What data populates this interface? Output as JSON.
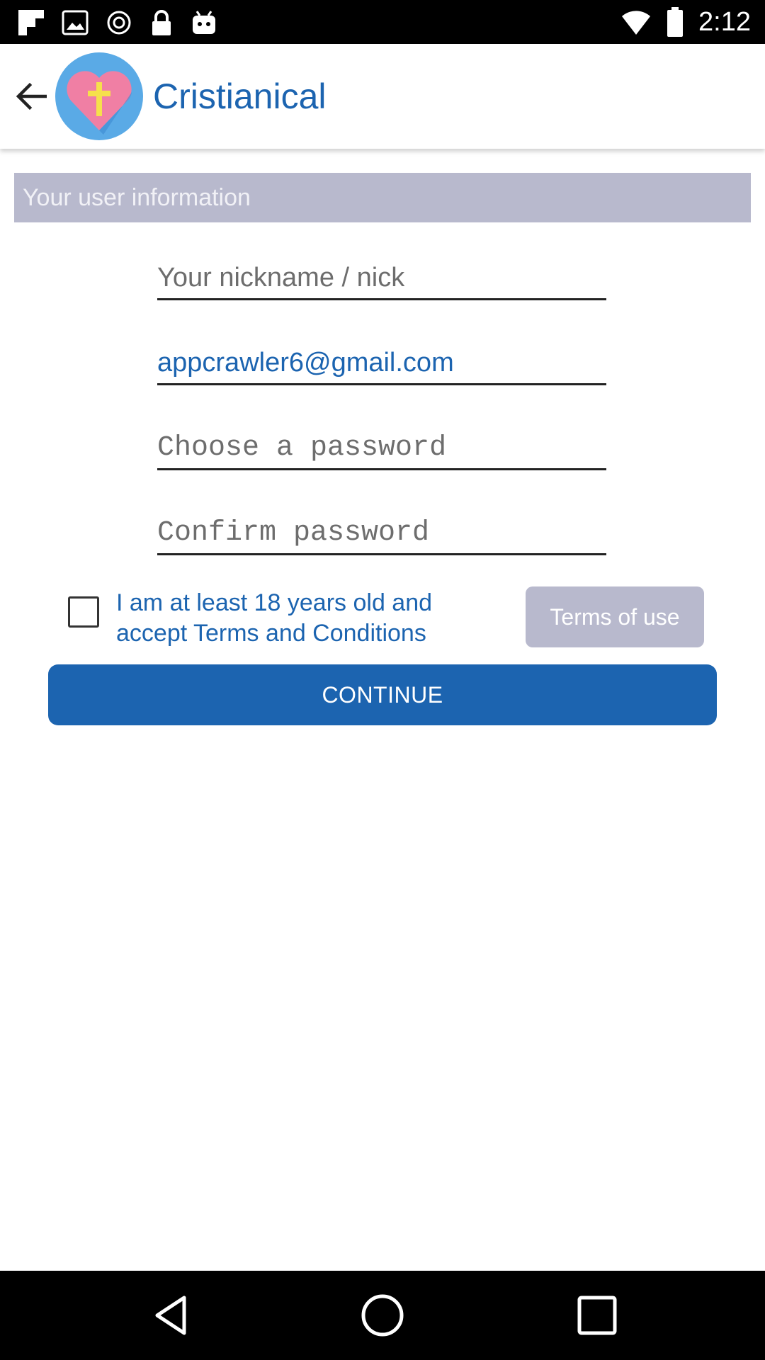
{
  "status_bar": {
    "time": "2:12",
    "icons": [
      "flipboard-icon",
      "image-icon",
      "sync-icon",
      "lock-icon",
      "android-icon",
      "wifi-icon",
      "battery-icon"
    ]
  },
  "toolbar": {
    "title": "Cristianical",
    "back_icon": "arrow-left-icon",
    "logo_icon": "heart-cross-logo"
  },
  "section": {
    "title": "Your user information"
  },
  "form": {
    "nickname_placeholder": "Your nickname / nick",
    "nickname_value": "",
    "email_value": "appcrawler6@gmail.com",
    "email_placeholder": "",
    "password_placeholder": "Choose a password",
    "confirm_placeholder": "Confirm password",
    "age_checkbox_label": "I am at least 18 years old and accept Terms and Conditions",
    "age_checked": false,
    "terms_button": "Terms of use",
    "continue_button": "CONTINUE"
  },
  "colors": {
    "accent": "#1c64b0",
    "section_bg": "#b8b9cd",
    "status_bar": "#000000",
    "nav_bar": "#000000"
  },
  "nav_bar": {
    "icons": [
      "nav-back-icon",
      "nav-home-icon",
      "nav-recents-icon"
    ]
  }
}
